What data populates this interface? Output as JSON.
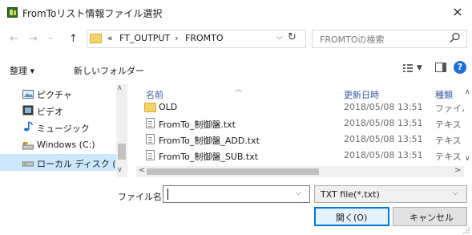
{
  "window": {
    "title": "FromToリスト情報ファイル選択",
    "close": "×"
  },
  "nav": {
    "back": "←",
    "forward": "→",
    "recent": "⌄",
    "up": "↑",
    "overflow": "«",
    "path": [
      "FT_OUTPUT",
      "FROMTO"
    ],
    "separator": "›",
    "refresh": "↻",
    "search_placeholder": "FROMTOの検索"
  },
  "toolbar": {
    "organize": "整理 ▾",
    "new_folder": "新しいフォルダー",
    "help": "?"
  },
  "sidebar": {
    "items": [
      {
        "label": "ピクチャ",
        "icon": "pictures-icon"
      },
      {
        "label": "ビデオ",
        "icon": "videos-icon"
      },
      {
        "label": "ミュージック",
        "icon": "music-icon"
      },
      {
        "label": "Windows (C:)",
        "icon": "drive-icon"
      },
      {
        "label": "ローカル ディスク (D",
        "icon": "drive-icon",
        "selected": true
      }
    ]
  },
  "columns": {
    "name": "名前",
    "date": "更新日時",
    "type": "種類"
  },
  "files": [
    {
      "name": "OLD",
      "date": "2018/05/08 13:51",
      "type": "ファイル",
      "kind": "folder"
    },
    {
      "name": "FromTo_制御盤.txt",
      "date": "2018/05/08 13:51",
      "type": "テキスト",
      "kind": "text"
    },
    {
      "name": "FromTo_制御盤_ADD.txt",
      "date": "2018/05/08 13:51",
      "type": "テキスト",
      "kind": "text"
    },
    {
      "name": "FromTo_制御盤_SUB.txt",
      "date": "2018/05/08 13:51",
      "type": "テキスト",
      "kind": "text"
    }
  ],
  "footer": {
    "filename_label": "ファイル名(N):",
    "filename_value": "",
    "filter": "TXT file(*.txt)",
    "open_button": "開く(O)",
    "cancel_button": "キャンセル"
  },
  "colors": {
    "accent": "#0078d7",
    "selection": "#cce8ff",
    "folder": "#f6d36a"
  }
}
